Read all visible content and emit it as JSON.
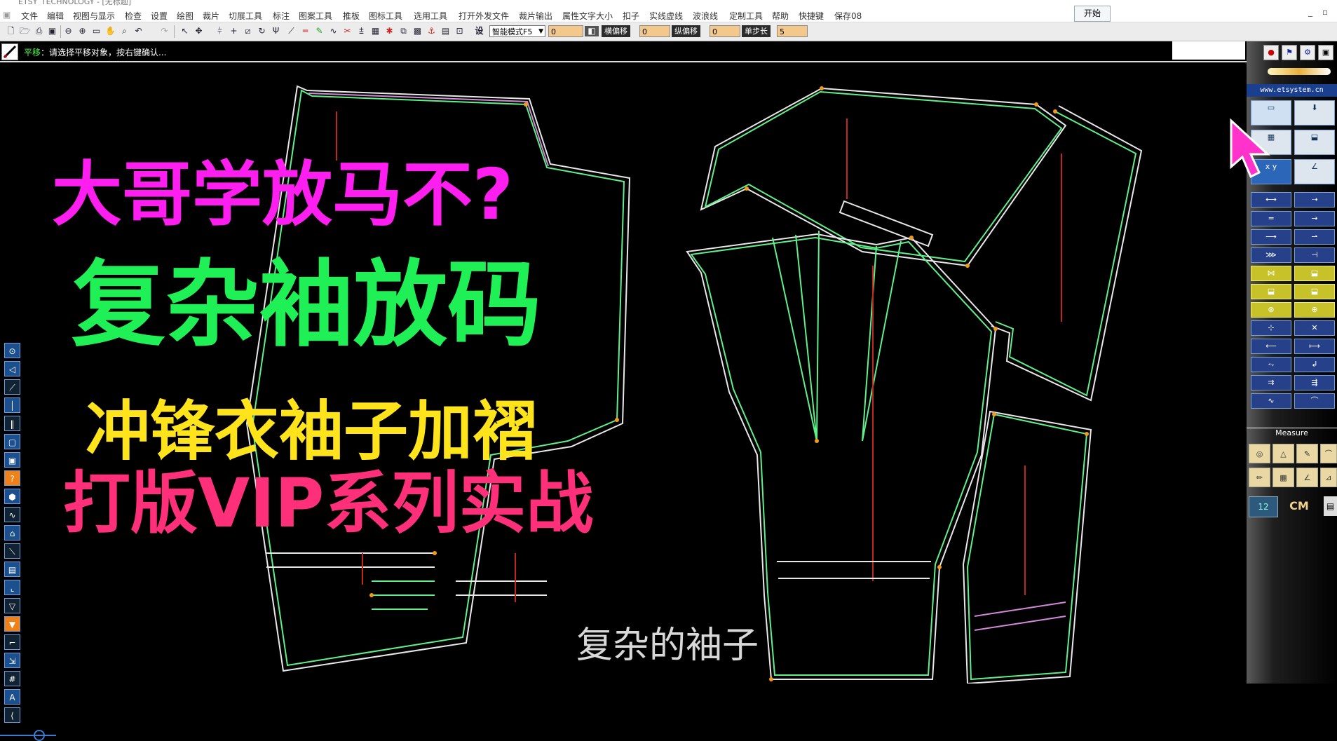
{
  "window": {
    "title": "ETSY_TECHNOLOGY - [无标题]"
  },
  "menu": [
    "文件",
    "编辑",
    "视图与显示",
    "检查",
    "设置",
    "绘图",
    "裁片",
    "切展工具",
    "标注",
    "图案工具",
    "推板",
    "图标工具",
    "选用工具",
    "打开外发文件",
    "裁片输出",
    "属性文字大小",
    "扣子",
    "实线虚线",
    "波浪线",
    "定制工具",
    "帮助",
    "快捷键",
    "保存08"
  ],
  "start_button": "开始",
  "window_controls": {
    "minimize": "_",
    "restore": "▫"
  },
  "toolbar": {
    "settings_label": "设",
    "mode_select": "智能模式F5",
    "value_box_1": "0",
    "h_offset_label": "横偏移",
    "h_offset_value": "0",
    "v_offset_label": "纵偏移",
    "v_offset_value": "0",
    "step_label": "单步长",
    "step_value": "5"
  },
  "status": {
    "command": "平移",
    "prompt": "：请选择平移对象，按右键确认..."
  },
  "right_panel": {
    "url": "www.etsystem.cn",
    "measure_label": "Measure",
    "unit_value": "12",
    "unit": "CM",
    "xy_label": "x y"
  },
  "overlay": {
    "line1": "大哥学放马不?",
    "line2": "复杂袖放码",
    "line3": "冲锋衣袖子加褶",
    "line4": "打版VIP系列实战",
    "subtitle": "复杂的袖子"
  },
  "colors": {
    "magenta": "#ff1ef0",
    "green": "#1ff055",
    "yellow": "#ffe41b",
    "pink": "#ff2f7a",
    "pattern_line": "#5ff08a"
  },
  "icons": [
    "new-file-icon",
    "open-icon",
    "save-icon",
    "zoom-in-icon",
    "zoom-out-icon",
    "pan-icon",
    "undo-icon",
    "redo-icon",
    "select-icon",
    "move-icon",
    "pointer-cursor-icon"
  ]
}
